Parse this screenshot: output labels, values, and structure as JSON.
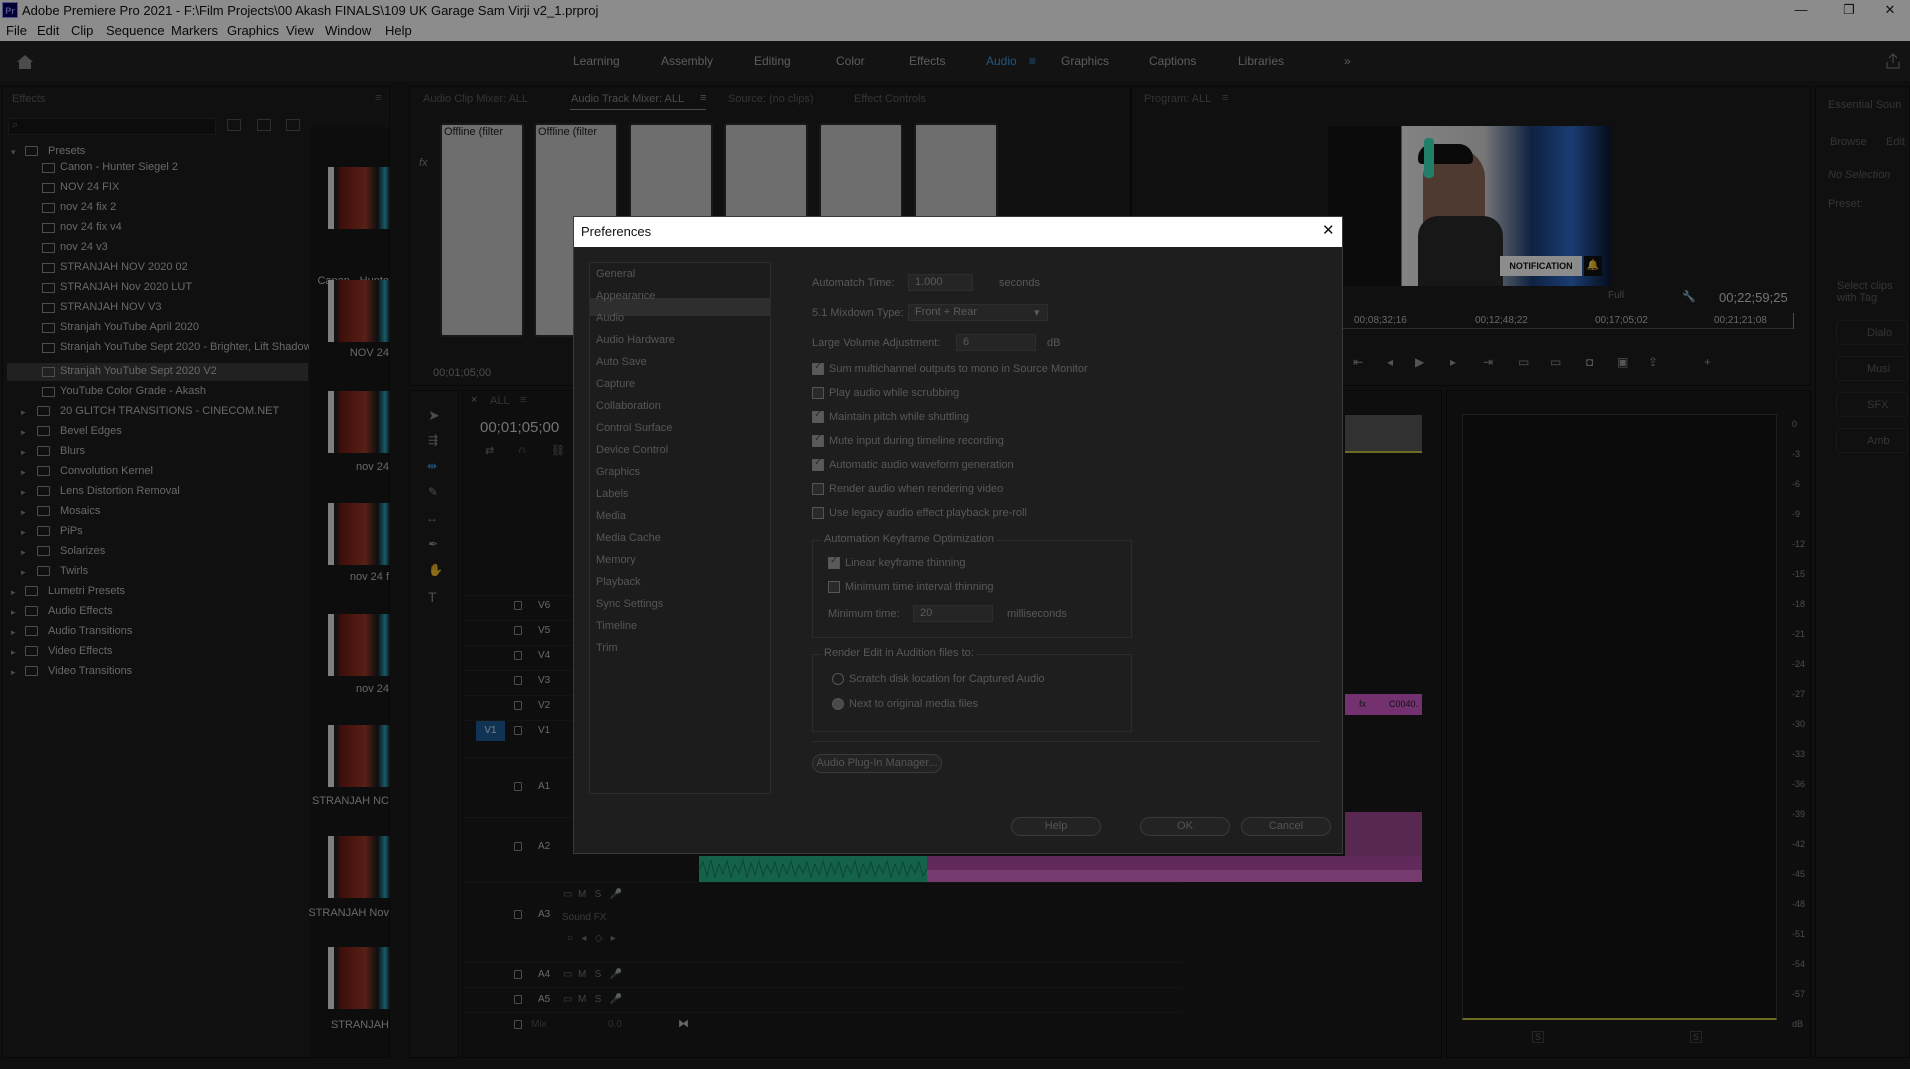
{
  "app": {
    "title": "Adobe Premiere Pro 2021 - F:\\Film Projects\\00 Akash FINALS\\109 UK Garage Sam Virji v2_1.prproj",
    "icon_text": "Pr"
  },
  "menu": [
    "File",
    "Edit",
    "Clip",
    "Sequence",
    "Markers",
    "Graphics",
    "View",
    "Window",
    "Help"
  ],
  "workspaces": [
    "Learning",
    "Assembly",
    "Editing",
    "Color",
    "Effects",
    "Audio",
    "Graphics",
    "Captions",
    "Libraries"
  ],
  "workspace_active": "Audio",
  "effects_panel": {
    "tab": "Effects",
    "presets_label": "Presets",
    "presets": [
      "Canon - Hunter Siegel 2",
      "NOV 24 FIX",
      "nov 24 fix 2",
      "nov 24 fix v4",
      "nov 24 v3",
      "STRANJAH NOV 2020 02",
      "STRANJAH Nov 2020 LUT",
      "STRANJAH NOV V3",
      "Stranjah YouTube April 2020",
      "Stranjah YouTube Sept 2020 - Brighter, Lift Shadow",
      "Stranjah YouTube Sept 2020 V2",
      "YouTube Color Grade - Akash"
    ],
    "selected_preset": "Stranjah YouTube Sept 2020 V2",
    "preset_folders": [
      "20 GLITCH TRANSITIONS - CINECOM.NET",
      "Bevel Edges",
      "Blurs",
      "Convolution Kernel",
      "Lens Distortion Removal",
      "Mosaics",
      "PiPs",
      "Solarizes",
      "Twirls"
    ],
    "root_folders": [
      "Lumetri Presets",
      "Audio Effects",
      "Audio Transitions",
      "Video Effects",
      "Video Transitions"
    ]
  },
  "thumbnails": [
    "Canon - Hunte",
    "NOV 24",
    "nov 24",
    "nov 24 f",
    "nov 24",
    "STRANJAH NC",
    "STRANJAH Nov",
    "STRANJAH"
  ],
  "mixer": {
    "tabs": [
      "Audio Clip Mixer: ALL",
      "Audio Track Mixer: ALL",
      "Source: (no clips)",
      "Effect Controls"
    ],
    "channel_labels": [
      "Offline (filter",
      "Offline (filter",
      "",
      "",
      "",
      ""
    ],
    "timecode": "00;01;05;00"
  },
  "program": {
    "tab": "Program: ALL",
    "notification_text": "NOTIFICATION",
    "fit": "Full",
    "duration": "00;22;59;25",
    "ruler": [
      "00;08;32;16",
      "00;12;48;22",
      "00;17;05;02",
      "00;21;21;08"
    ]
  },
  "essential_sound": {
    "tab": "Essential Soun",
    "subtabs": [
      "Browse",
      "Edit"
    ],
    "no_selection": "No Selection",
    "preset_label": "Preset:",
    "hint": "Select clips with Tag",
    "types": [
      "Dialo",
      "Musi",
      "SFX",
      "Amb"
    ]
  },
  "timeline": {
    "tab": "ALL",
    "timecode": "00;01;05;00",
    "video_tracks": [
      "V6",
      "V5",
      "V4",
      "V3",
      "V2",
      "V1"
    ],
    "audio_tracks": [
      "A1",
      "A2",
      "A3",
      "A4",
      "A5"
    ],
    "target_label": "V1",
    "a3_name": "Sound FX",
    "mix_label": "Mix",
    "mix_value": "0.0",
    "clip_label": "C0040."
  },
  "meter_scale": [
    "0",
    "-3",
    "-6",
    "-9",
    "-12",
    "-15",
    "-18",
    "-21",
    "-24",
    "-27",
    "-30",
    "-33",
    "-36",
    "-39",
    "-42",
    "-45",
    "-48",
    "-51",
    "-54",
    "-57",
    "dB"
  ],
  "dialog": {
    "title": "Preferences",
    "nav": [
      "General",
      "Appearance",
      "Audio",
      "Audio Hardware",
      "Auto Save",
      "Capture",
      "Collaboration",
      "Control Surface",
      "Device Control",
      "Graphics",
      "Labels",
      "Media",
      "Media Cache",
      "Memory",
      "Playback",
      "Sync Settings",
      "Timeline",
      "Trim"
    ],
    "nav_selected": "Audio",
    "automatch_label": "Automatch Time:",
    "automatch_value": "1.000",
    "automatch_unit": "seconds",
    "mixdown_label": "5.1 Mixdown Type:",
    "mixdown_value": "Front + Rear",
    "volume_label": "Large Volume Adjustment:",
    "volume_value": "6",
    "volume_unit": "dB",
    "checkboxes": [
      {
        "label": "Sum multichannel outputs to mono in Source Monitor",
        "checked": true
      },
      {
        "label": "Play audio while scrubbing",
        "checked": false
      },
      {
        "label": "Maintain pitch while shuttling",
        "checked": true
      },
      {
        "label": "Mute input during timeline recording",
        "checked": true
      },
      {
        "label": "Automatic audio waveform generation",
        "checked": true
      },
      {
        "label": "Render audio when rendering video",
        "checked": false
      },
      {
        "label": "Use legacy audio effect playback pre-roll",
        "checked": false
      }
    ],
    "keyframe_group": "Automation Keyframe Optimization",
    "linear_thinning": "Linear keyframe thinning",
    "min_interval": "Minimum time interval thinning",
    "min_time_label": "Minimum time:",
    "min_time_value": "20",
    "min_time_unit": "milliseconds",
    "audition_group": "Render Edit in Audition files to:",
    "radio1": "Scratch disk location for Captured Audio",
    "radio2": "Next to original media files",
    "plugin_btn": "Audio Plug-In Manager...",
    "help_btn": "Help",
    "ok_btn": "OK",
    "cancel_btn": "Cancel"
  }
}
